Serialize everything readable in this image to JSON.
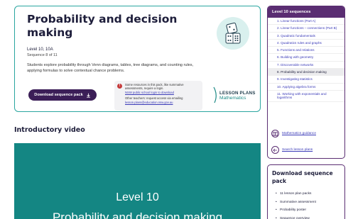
{
  "hero": {
    "title": "Probability and decision making",
    "level": "Level 10, 10A",
    "sequence": "Sequence 8 of 11",
    "description": "Students explore probability through Venn diagrams, tables, tree diagrams, and counting rules, applying formulas to solve contextual chance problems.",
    "download_label": "Download sequence pack",
    "notice_text": "Some resources in this pack, like summative assessments, require a login.",
    "notice_link1": "NSW public school login to download",
    "notice_text2": "Other teachers: request access via emailing",
    "notice_link2": "lesson.plans@education.nsw.gov.au",
    "logo_line1": "LESSON PLANS",
    "logo_line2": "Mathematics"
  },
  "video": {
    "heading": "Introductory video",
    "level_text": "Level 10",
    "title_text": "Probability and decision making"
  },
  "sequences": {
    "heading": "Level 10 sequences",
    "items": [
      {
        "label": "1. Linear functions (Part A)"
      },
      {
        "label": "2. Linear functions – connections (Part B)"
      },
      {
        "label": "3. Quadratic fundamentals"
      },
      {
        "label": "4. Quadratics rules and graphs"
      },
      {
        "label": "5. Functions and relations"
      },
      {
        "label": "6. Building with geometry"
      },
      {
        "label": "7. Discoverable networks"
      },
      {
        "label": "8. Probability and decision making",
        "active": true
      },
      {
        "label": "9. Investigating statistics"
      },
      {
        "label": "10. Applying algebra forms"
      },
      {
        "label": "11. Working with exponentials and logarithms"
      }
    ],
    "guidance_link": "Mathematics guidance",
    "search_link": "Search lesson plans"
  },
  "download_panel": {
    "title": "Download sequence pack",
    "items": [
      "11 lesson plan packs",
      "Summative assessment",
      "Probability poster",
      "Sequence overview"
    ]
  },
  "colors": {
    "purple": "#5a2d72",
    "teal": "#148683",
    "button": "#3b1e57",
    "link": "#3a3ab8"
  }
}
